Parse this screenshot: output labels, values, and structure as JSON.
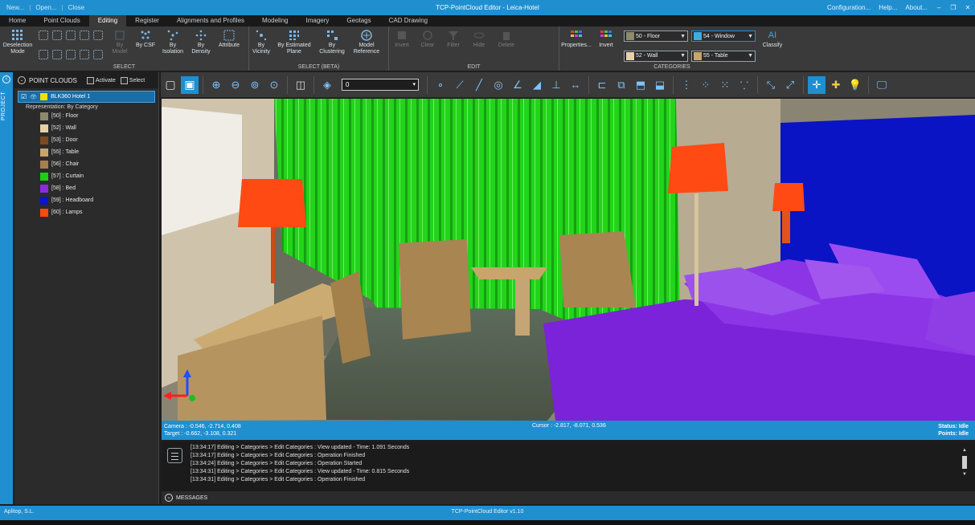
{
  "window": {
    "title": "TCP-PointCloud Editor - Leica-Hotel",
    "quick_access": [
      "New...",
      "Open...",
      "Close"
    ],
    "right_links": [
      "Configuration...",
      "Help...",
      "About..."
    ],
    "min": "–",
    "max": "❐",
    "close": "✕"
  },
  "menu": {
    "tabs": [
      "Home",
      "Point Clouds",
      "Editing",
      "Register",
      "Alignments and Profiles",
      "Modeling",
      "Imagery",
      "Geotags",
      "CAD Drawing"
    ],
    "active": "Editing"
  },
  "ribbon": {
    "select": {
      "label": "SELECT",
      "deselection": "Deselection Mode",
      "buttons": [
        {
          "label": "By Model",
          "disabled": true,
          "icon": "cube-icon"
        },
        {
          "label": "By CSF",
          "disabled": false,
          "icon": "csf-icon"
        },
        {
          "label": "By Isolation",
          "disabled": false,
          "icon": "isolation-icon"
        },
        {
          "label": "By Density",
          "disabled": false,
          "icon": "density-icon"
        },
        {
          "label": "Attribute",
          "disabled": false,
          "icon": "attribute-icon"
        }
      ]
    },
    "select_beta": {
      "label": "SELECT (BETA)",
      "buttons": [
        {
          "label": "By Vicinity",
          "icon": "vicinity-icon"
        },
        {
          "label": "By Estimated Plane",
          "icon": "plane-icon"
        },
        {
          "label": "By Clustering",
          "icon": "clustering-icon"
        },
        {
          "label": "Model Reference",
          "icon": "model-reference-icon"
        }
      ]
    },
    "edit": {
      "label": "EDIT",
      "buttons": [
        "Invert",
        "Clear",
        "Filter",
        "Hide",
        "Delete"
      ]
    },
    "categories": {
      "label": "CATEGORIES",
      "properties": "Properties...",
      "invert": "Invert",
      "selectors": [
        {
          "text": "50 - Floor",
          "color": "#8b8b6d"
        },
        {
          "text": "54 - Window",
          "color": "#45a9dc"
        },
        {
          "text": "52 - Wall",
          "color": "#e6d2a6"
        },
        {
          "text": "55 - Table",
          "color": "#c9a46b"
        }
      ],
      "ai_label": "AI",
      "classify": "Classify"
    }
  },
  "panel": {
    "title": "POINT CLOUDS",
    "activate": "Activate",
    "select": "Select",
    "side_label": "PROJECT",
    "root": "BLK360 Hotel 1",
    "representation": "Representation: By Category",
    "categories": [
      {
        "label": "[50] : Floor",
        "color": "#8b8b6d"
      },
      {
        "label": "[52] : Wall",
        "color": "#e6d2a6"
      },
      {
        "label": "[53] : Door",
        "color": "#7a4b22"
      },
      {
        "label": "[55] : Table",
        "color": "#c9a46b"
      },
      {
        "label": "[56] : Chair",
        "color": "#a6804d"
      },
      {
        "label": "[57] : Curtain",
        "color": "#19d012"
      },
      {
        "label": "[58] : Bed",
        "color": "#8a2be2"
      },
      {
        "label": "[59] : Headboard",
        "color": "#0a14c8"
      },
      {
        "label": "[60] : Lamps",
        "color": "#ff4a14"
      }
    ]
  },
  "toolbar": {
    "layer_value": "0"
  },
  "info": {
    "camera": "Camera : -0.546, -2.714, 0.408",
    "target": "Target : -0.662, -3.108, 0.321",
    "cursor": "Cursor : -2.817, -8.071, 0.536",
    "status": "Status: Idle",
    "points": "Points: Idle"
  },
  "log": {
    "lines": [
      "[13:34:17] Editing > Categories > Edit Categories : View updated - Time: 1.091 Seconds",
      "[13:34:17] Editing > Categories > Edit Categories : Operation Finished",
      "[13:34:24] Editing > Categories > Edit Categories : Operation Started",
      "[13:34:31] Editing > Categories > Edit Categories : View updated - Time: 0.815 Seconds",
      "[13:34:31] Editing > Categories > Edit Categories : Operation Finished"
    ],
    "messages": "MESSAGES"
  },
  "status": {
    "company": "Aplitop, S.L.",
    "version": "TCP-PointCloud Editor v1.10"
  }
}
